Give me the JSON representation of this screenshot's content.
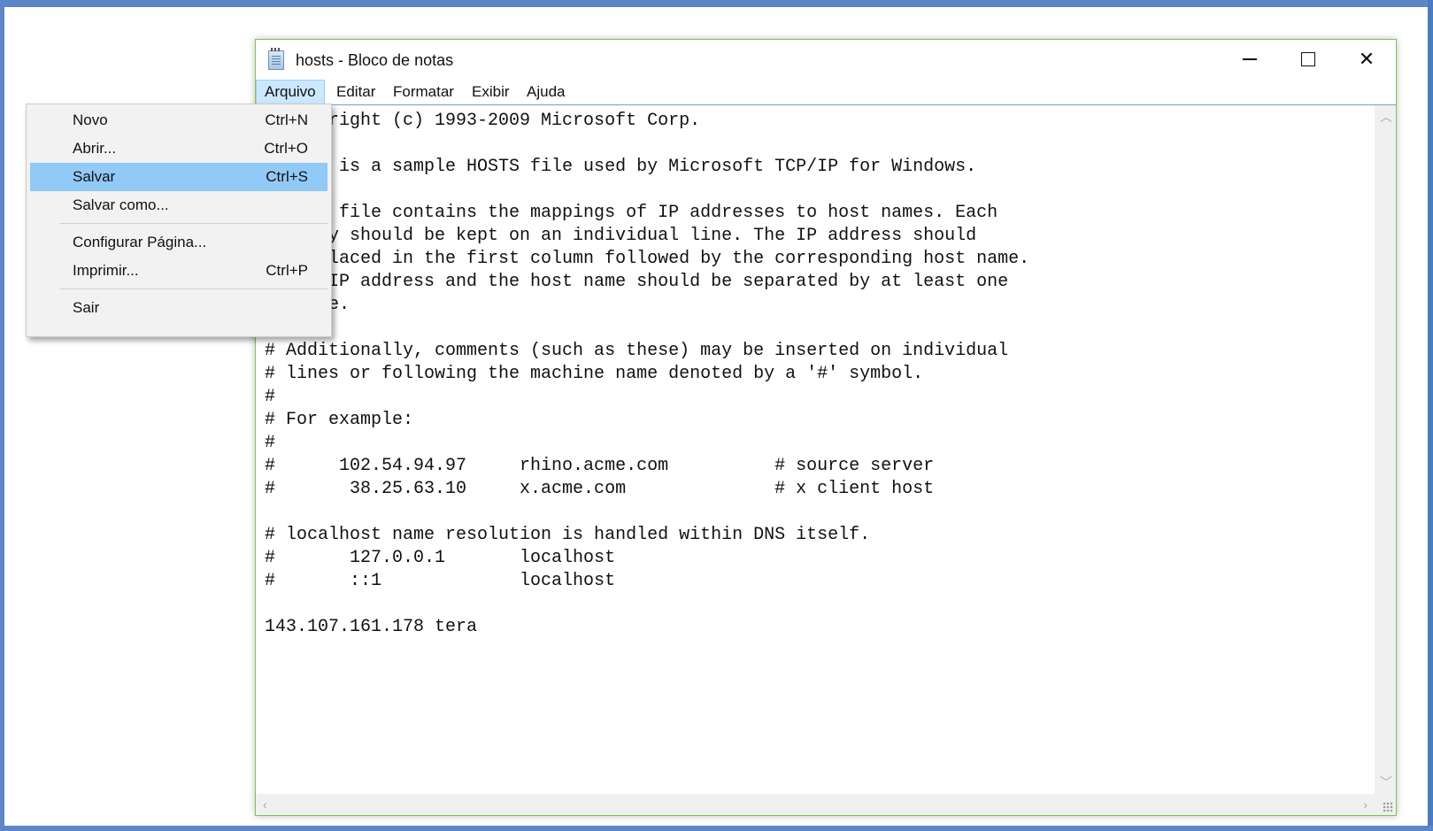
{
  "window": {
    "title": "hosts - Bloco de notas",
    "controls": {
      "minimize": "minimize-icon",
      "maximize": "maximize-icon",
      "close": "close-icon"
    }
  },
  "menubar": [
    "Arquivo",
    "Editar",
    "Formatar",
    "Exibir",
    "Ajuda"
  ],
  "file_menu": {
    "items": [
      {
        "label": "Novo",
        "shortcut": "Ctrl+N"
      },
      {
        "label": "Abrir...",
        "shortcut": "Ctrl+O"
      },
      {
        "label": "Salvar",
        "shortcut": "Ctrl+S",
        "highlighted": true
      },
      {
        "label": "Salvar como...",
        "shortcut": ""
      },
      {
        "label": "Configurar Página...",
        "shortcut": ""
      },
      {
        "label": "Imprimir...",
        "shortcut": "Ctrl+P"
      },
      {
        "label": "Sair",
        "shortcut": ""
      }
    ]
  },
  "document": {
    "lines": [
      "# Copyright (c) 1993-2009 Microsoft Corp.",
      "#",
      "# This is a sample HOSTS file used by Microsoft TCP/IP for Windows.",
      "#",
      "# This file contains the mappings of IP addresses to host names. Each",
      "# entry should be kept on an individual line. The IP address should",
      "# be placed in the first column followed by the corresponding host name.",
      "# The IP address and the host name should be separated by at least one",
      "# space.",
      "#",
      "# Additionally, comments (such as these) may be inserted on individual",
      "# lines or following the machine name denoted by a '#' symbol.",
      "#",
      "# For example:",
      "#",
      "#      102.54.94.97     rhino.acme.com          # source server",
      "#       38.25.63.10     x.acme.com              # x client host",
      "",
      "# localhost name resolution is handled within DNS itself.",
      "#       127.0.0.1       localhost",
      "#       ::1             localhost",
      "",
      "143.107.161.178 tera"
    ]
  }
}
